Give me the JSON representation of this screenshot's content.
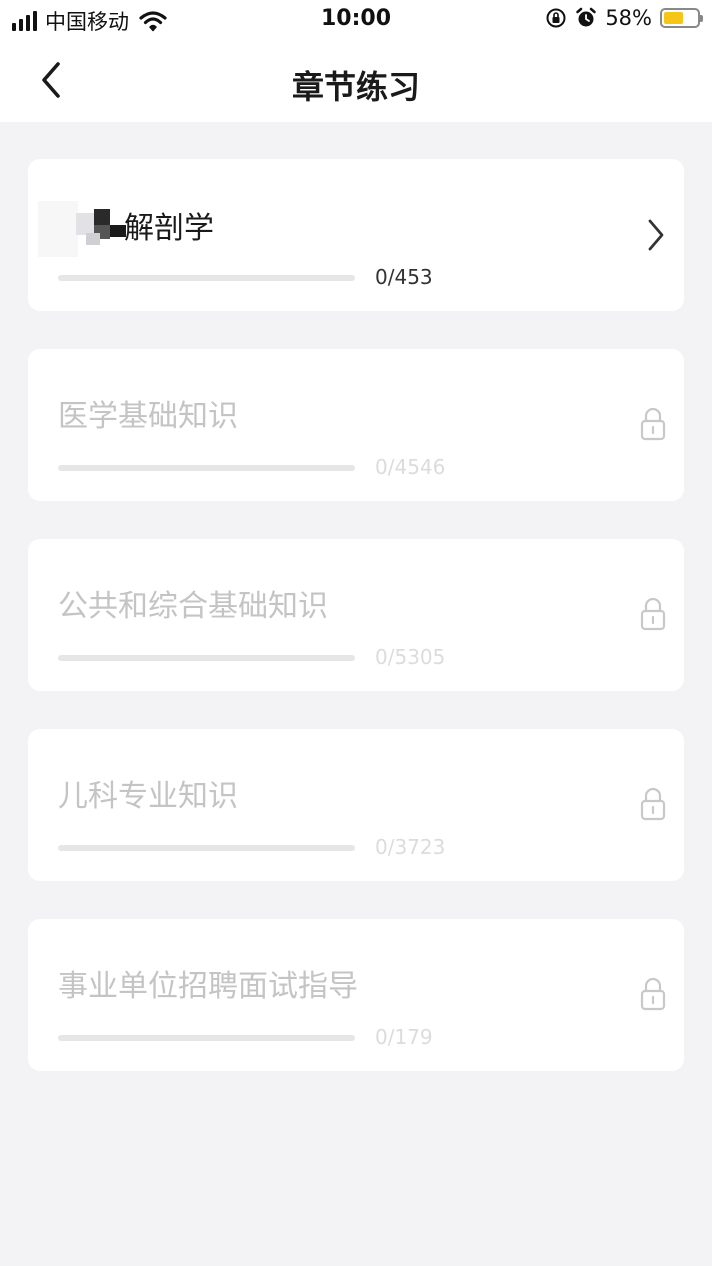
{
  "status_bar": {
    "carrier": "中国移动",
    "time": "10:00",
    "battery_percent": "58%",
    "battery_level": 0.58
  },
  "nav": {
    "title": "章节练习",
    "back_icon": "chevron-left-icon"
  },
  "chapters": [
    {
      "title": "解剖学",
      "progress": "0/453",
      "locked": false,
      "fraction": 0
    },
    {
      "title": "医学基础知识",
      "progress": "0/4546",
      "locked": true,
      "fraction": 0
    },
    {
      "title": "公共和综合基础知识",
      "progress": "0/5305",
      "locked": true,
      "fraction": 0
    },
    {
      "title": "儿科专业知识",
      "progress": "0/3723",
      "locked": true,
      "fraction": 0
    },
    {
      "title": "事业单位招聘面试指导",
      "progress": "0/179",
      "locked": true,
      "fraction": 0
    }
  ],
  "colors": {
    "background": "#f3f3f6",
    "card": "#ffffff",
    "locked_text": "#c4c4c4",
    "battery": "#f5c518"
  }
}
